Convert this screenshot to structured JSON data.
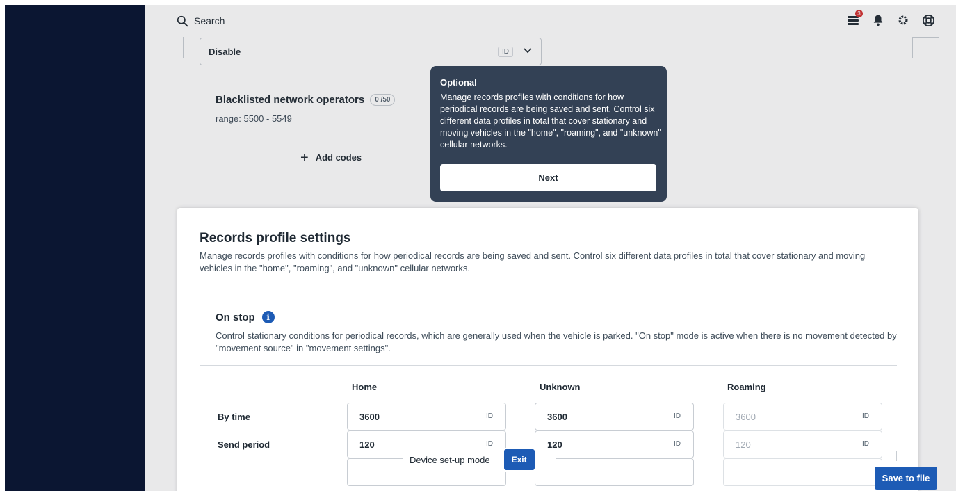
{
  "topbar": {
    "search_label": "Search",
    "icons": [
      "search-icon",
      "messages-icon",
      "bell-icon",
      "gear-icon",
      "support-icon"
    ],
    "notification_count": "3"
  },
  "background": {
    "select_value": "Disable",
    "select_id_tag": "ID",
    "blacklist_title": "Blacklisted network operators",
    "blacklist_count": "0 /50",
    "blacklist_range": "range: 5500 - 5549",
    "add_codes_label": "Add codes"
  },
  "tooltip": {
    "title": "Optional",
    "body": "Manage records profiles with conditions for how periodical records are being saved and sent. Control six different data profiles in total that cover stationary and moving vehicles in the \"home\", \"roaming\", and \"unknown\" cellular networks.",
    "next_label": "Next"
  },
  "panel": {
    "title": "Records profile settings",
    "description": "Manage records profiles with conditions for how periodical records are being saved and sent. Control six different data profiles in total that cover stationary and moving vehicles in the \"home\", \"roaming\", and \"unknown\" cellular networks.",
    "section": {
      "title": "On stop",
      "description": "Control stationary conditions for periodical records, which are generally used when the vehicle is parked. \"On stop\" mode is active when there is no movement detected by \"movement source\" in \"movement settings\".",
      "columns": [
        "Home",
        "Unknown",
        "Roaming"
      ],
      "rows": [
        {
          "label": "By time",
          "values": [
            "3600",
            "3600",
            "3600"
          ]
        },
        {
          "label": "Send period",
          "values": [
            "120",
            "120",
            "120"
          ]
        }
      ],
      "id_tag": "ID"
    }
  },
  "footer": {
    "setup_mode_label": "Device set-up mode",
    "exit_label": "Exit",
    "save_label": "Save to file"
  },
  "colors": {
    "sidebar": "#0b1632",
    "primary": "#1d5bb5",
    "tooltip_bg": "#334155"
  }
}
